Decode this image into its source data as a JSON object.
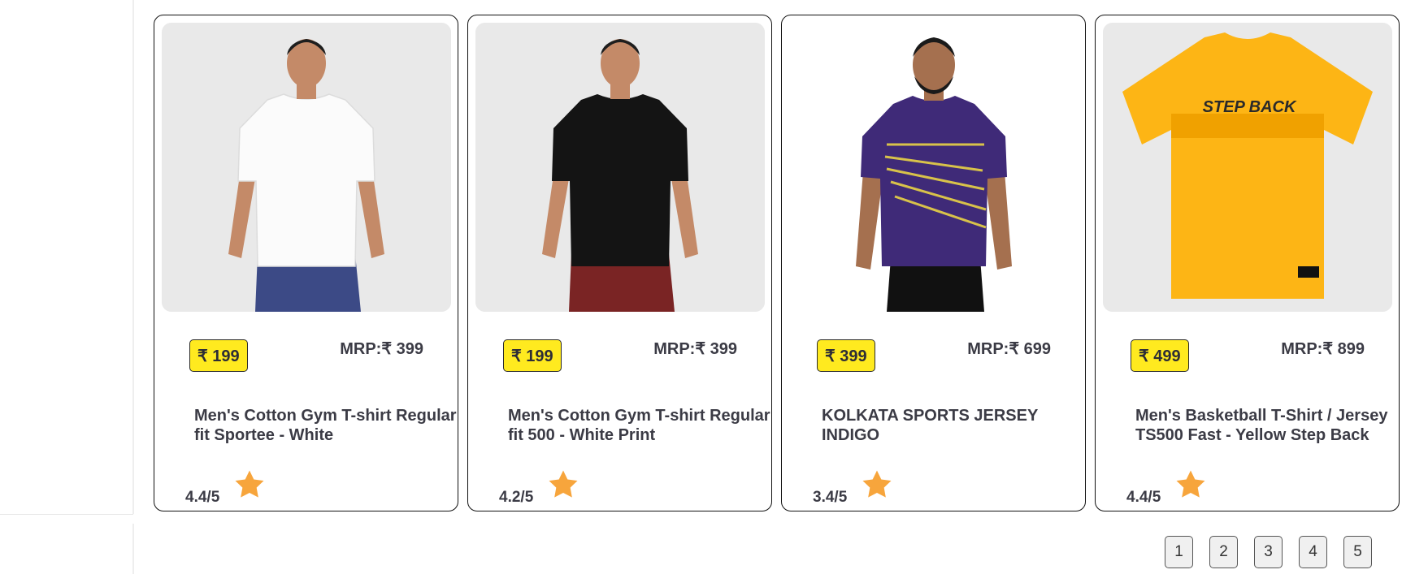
{
  "colors": {
    "price_badge_bg": "#ffea1f",
    "star": "#f7a53c",
    "text": "#3b3b45"
  },
  "products": [
    {
      "price": "₹ 199",
      "mrp": "MRP:₹ 399",
      "title": "Men's Cotton Gym T-shirt Regular fit Sportee - White",
      "rating": "4.4/5",
      "image": "model-white-tshirt"
    },
    {
      "price": "₹ 199",
      "mrp": "MRP:₹ 399",
      "title": "Men's Cotton Gym T-shirt Regular fit 500 - White Print",
      "rating": "4.2/5",
      "image": "model-black-tshirt"
    },
    {
      "price": "₹ 399",
      "mrp": "MRP:₹ 699",
      "title": "KOLKATA SPORTS JERSEY INDIGO",
      "rating": "3.4/5",
      "image": "model-indigo-jersey"
    },
    {
      "price": "₹ 499",
      "mrp": "MRP:₹ 899",
      "title": "Men's Basketball T-Shirt / Jersey TS500 Fast - Yellow Step Back",
      "rating": "4.4/5",
      "image": "yellow-step-back-tshirt",
      "shirt_print": "STEP BACK"
    }
  ],
  "pagination": {
    "pages": [
      "1",
      "2",
      "3",
      "4",
      "5"
    ]
  }
}
